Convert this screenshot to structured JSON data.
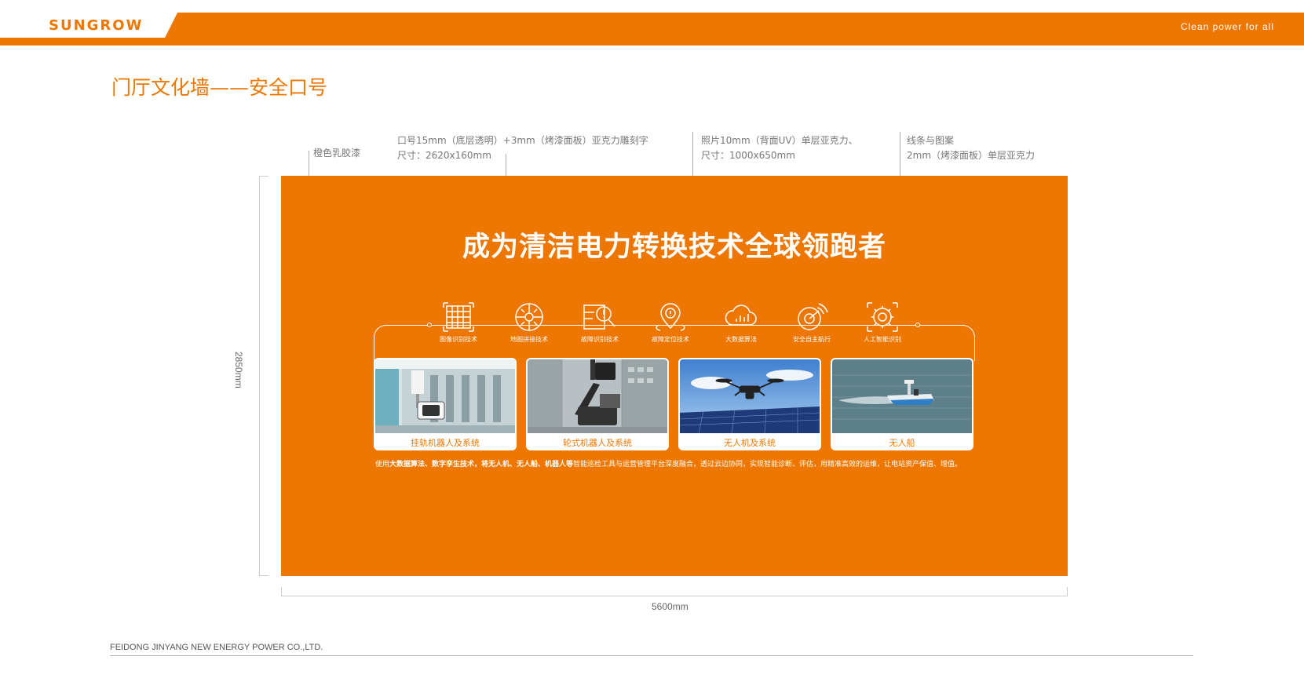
{
  "header": {
    "brand": "SUNGROW",
    "slogan": "Clean power for all",
    "accent": "#ee7703"
  },
  "page_title": "门厅文化墙——安全口号",
  "annotations": [
    {
      "lines": [
        "橙色乳胶漆"
      ]
    },
    {
      "lines": [
        "口号15mm（底层透明）+3mm（烤漆面板）亚克力雕刻字",
        "尺寸：2620x160mm"
      ]
    },
    {
      "lines": [
        "照片10mm（背面UV）单层亚克力、",
        "尺寸：1000x650mm"
      ]
    },
    {
      "lines": [
        "线条与图案",
        "2mm（烤漆面板）单层亚克力"
      ]
    }
  ],
  "dimensions": {
    "width_label": "5600mm",
    "height_label": "2850mm"
  },
  "wall": {
    "headline": "成为清洁电力转换技术全球领跑者",
    "icons": [
      {
        "icon": "grid-recognition-icon",
        "label": "图像识别技术"
      },
      {
        "icon": "map-puzzle-icon",
        "label": "地图拼接技术"
      },
      {
        "icon": "fault-search-icon",
        "label": "故障识别技术"
      },
      {
        "icon": "location-pin-icon",
        "label": "故障定位技术"
      },
      {
        "icon": "cloud-data-icon",
        "label": "大数据算法"
      },
      {
        "icon": "radar-autopilot-icon",
        "label": "安全自主航行"
      },
      {
        "icon": "ai-chip-icon",
        "label": "人工智能识别"
      }
    ],
    "cards": [
      {
        "label": "挂轨机器人及系统"
      },
      {
        "label": "轮式机器人及系统"
      },
      {
        "label": "无人机及系统"
      },
      {
        "label": "无人船"
      }
    ],
    "description_lead": "使用",
    "description_bold": "大数据算法、数字孪生技术，将无人机、无人船、机器人等",
    "description_rest": "智能巡检工具与运营管理平台深度融合，透过云边协同，实现智能诊断、评估，用精准高效的运维，让电站资产保值、增值。"
  },
  "footer": {
    "company": "FEIDONG JINYANG NEW ENERGY POWER CO.,LTD."
  }
}
